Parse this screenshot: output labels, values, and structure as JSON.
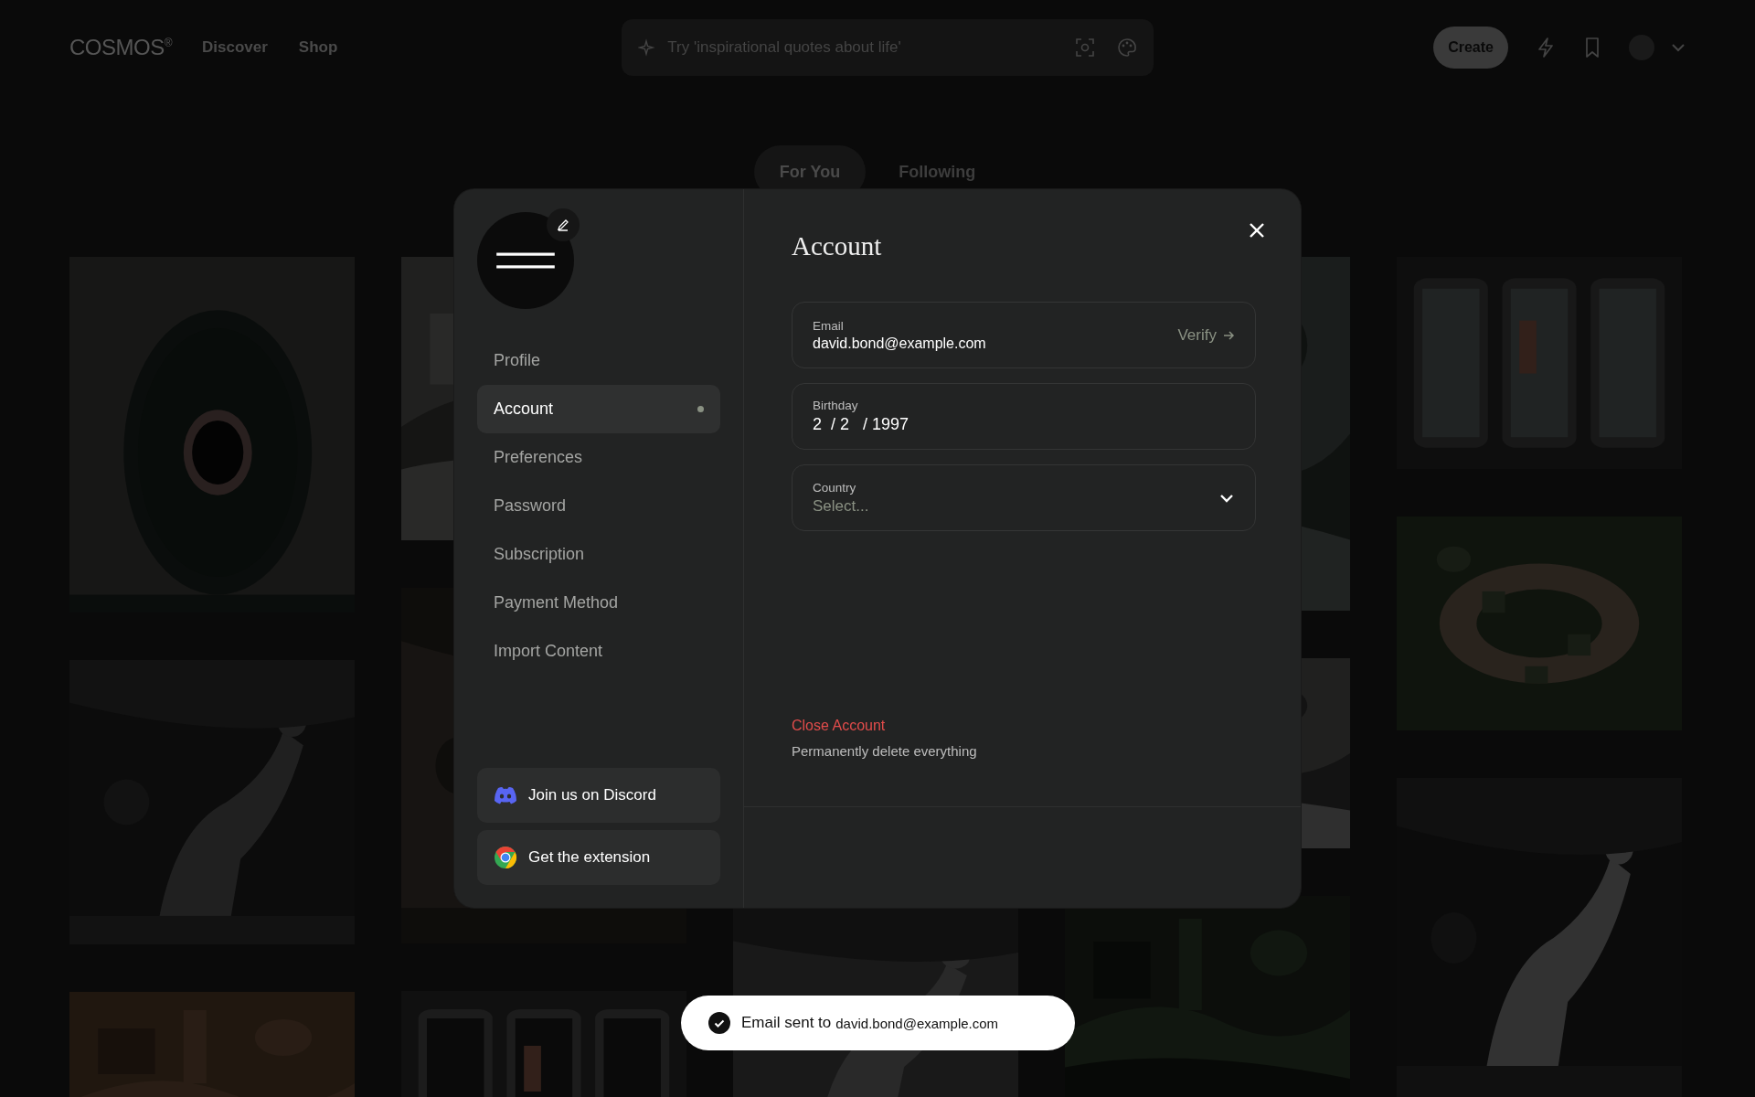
{
  "header": {
    "logo": "COSMOS$^{®}$",
    "nav": [
      "Discover",
      "Shop"
    ],
    "search": {
      "placeholder": "Try 'inspirational quotes about life'"
    },
    "create": "Create"
  },
  "tabs": [
    {
      "label": "For You",
      "selected": true
    },
    {
      "label": "Following",
      "selected": false
    }
  ],
  "modal": {
    "nav": [
      {
        "label": "Profile",
        "selected": false
      },
      {
        "label": "Account",
        "selected": true
      },
      {
        "label": "Preferences",
        "selected": false
      },
      {
        "label": "Password",
        "selected": false
      },
      {
        "label": "Subscription",
        "selected": false
      },
      {
        "label": "Payment Method",
        "selected": false
      },
      {
        "label": "Import Content",
        "selected": false
      }
    ],
    "links": [
      {
        "kind": "discord",
        "label": "Join us on Discord"
      },
      {
        "kind": "chrome",
        "label": "Get the extension"
      }
    ],
    "title": "Account",
    "fields": [
      {
        "kind": "email",
        "label": "Email",
        "value": "david.bond@example.com",
        "action": "Verify"
      },
      {
        "kind": "date",
        "label": "Birthday",
        "value": "2  / 2   / 1997"
      },
      {
        "kind": "select",
        "label": "Country",
        "placeholder": "Select..."
      }
    ],
    "danger": {
      "label": "Close Account",
      "description": "Permanently delete everything"
    }
  },
  "toast": {
    "message": "Email sent to",
    "email": "david.bond@example.com"
  }
}
